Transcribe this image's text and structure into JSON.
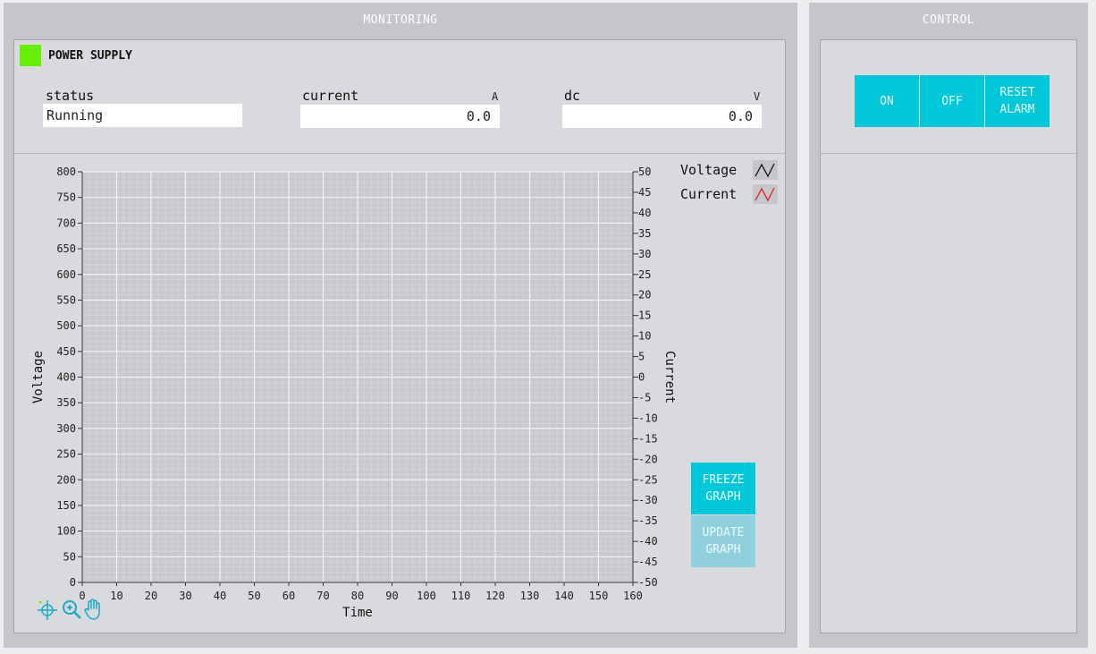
{
  "monitoring": {
    "title": "MONITORING",
    "device": {
      "name": "POWER SUPPLY",
      "indicator_color": "#66ee00"
    },
    "fields": {
      "status": {
        "label": "status",
        "unit": "",
        "value": "Running"
      },
      "current": {
        "label": "current",
        "unit": "A",
        "value": "0.0"
      },
      "dc": {
        "label": "dc",
        "unit": "V",
        "value": "0.0"
      }
    },
    "legend": [
      {
        "name": "Voltage",
        "color": "#111111"
      },
      {
        "name": "Current",
        "color": "#e02020"
      }
    ],
    "buttons": {
      "freeze": "FREEZE\nGRAPH",
      "update": "UPDATE\nGRAPH"
    },
    "tools": [
      "crosshair-icon",
      "zoom-in-icon",
      "pan-hand-icon"
    ]
  },
  "control": {
    "title": "CONTROL",
    "buttons": {
      "on": "ON",
      "off": "OFF",
      "reset": "RESET\nALARM"
    }
  },
  "colors": {
    "accent": "#00c8d8",
    "accent_disabled": "#8fd0dc",
    "panel": "#c4c6ca",
    "plot_bg": "#c8c9cc"
  },
  "chart_data": {
    "type": "line",
    "xlabel": "Time",
    "ylabel": "Voltage",
    "y2label": "Current",
    "xlim": [
      0,
      160
    ],
    "ylim": [
      0,
      800
    ],
    "y2lim": [
      -50,
      50
    ],
    "x_ticks": [
      0,
      10,
      20,
      30,
      40,
      50,
      60,
      70,
      80,
      90,
      100,
      110,
      120,
      130,
      140,
      150,
      160
    ],
    "y_ticks": [
      0,
      50,
      100,
      150,
      200,
      250,
      300,
      350,
      400,
      450,
      500,
      550,
      600,
      650,
      700,
      750,
      800
    ],
    "y2_ticks": [
      50,
      45,
      40,
      35,
      30,
      25,
      20,
      15,
      10,
      5,
      0,
      -5,
      -10,
      -15,
      -20,
      -25,
      -30,
      -35,
      -40,
      -45,
      -50
    ],
    "grid": true,
    "legend_position": "top-right",
    "series": [
      {
        "name": "Voltage",
        "values": []
      },
      {
        "name": "Current",
        "values": []
      }
    ]
  }
}
